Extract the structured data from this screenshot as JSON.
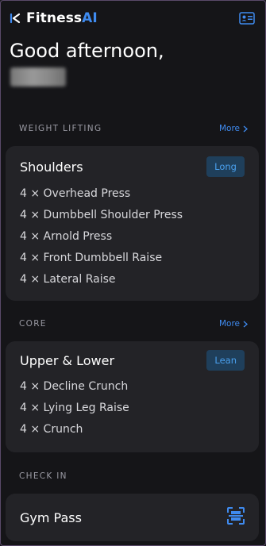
{
  "brand": {
    "name_main": "Fitness",
    "name_accent": "AI",
    "logo_icon": "fitness-logo-icon",
    "accent_color": "#3f8bf0"
  },
  "header": {
    "greeting": "Good afternoon,",
    "profile_icon": "id-card-icon"
  },
  "sections": [
    {
      "title": "WEIGHT LIFTING",
      "more_label": "More",
      "card": {
        "title": "Shoulders",
        "badge": "Long",
        "exercises": [
          "4 × Overhead Press",
          "4 × Dumbbell Shoulder Press",
          "4 × Arnold Press",
          "4 × Front Dumbbell Raise",
          "4 × Lateral Raise"
        ]
      }
    },
    {
      "title": "CORE",
      "more_label": "More",
      "card": {
        "title": "Upper & Lower",
        "badge": "Lean",
        "exercises": [
          "4 × Decline Crunch",
          "4 × Lying Leg Raise",
          "4 × Crunch"
        ]
      }
    }
  ],
  "check_in": {
    "title": "CHECK IN",
    "gym_pass_label": "Gym Pass",
    "scan_icon": "qr-scan-icon"
  }
}
